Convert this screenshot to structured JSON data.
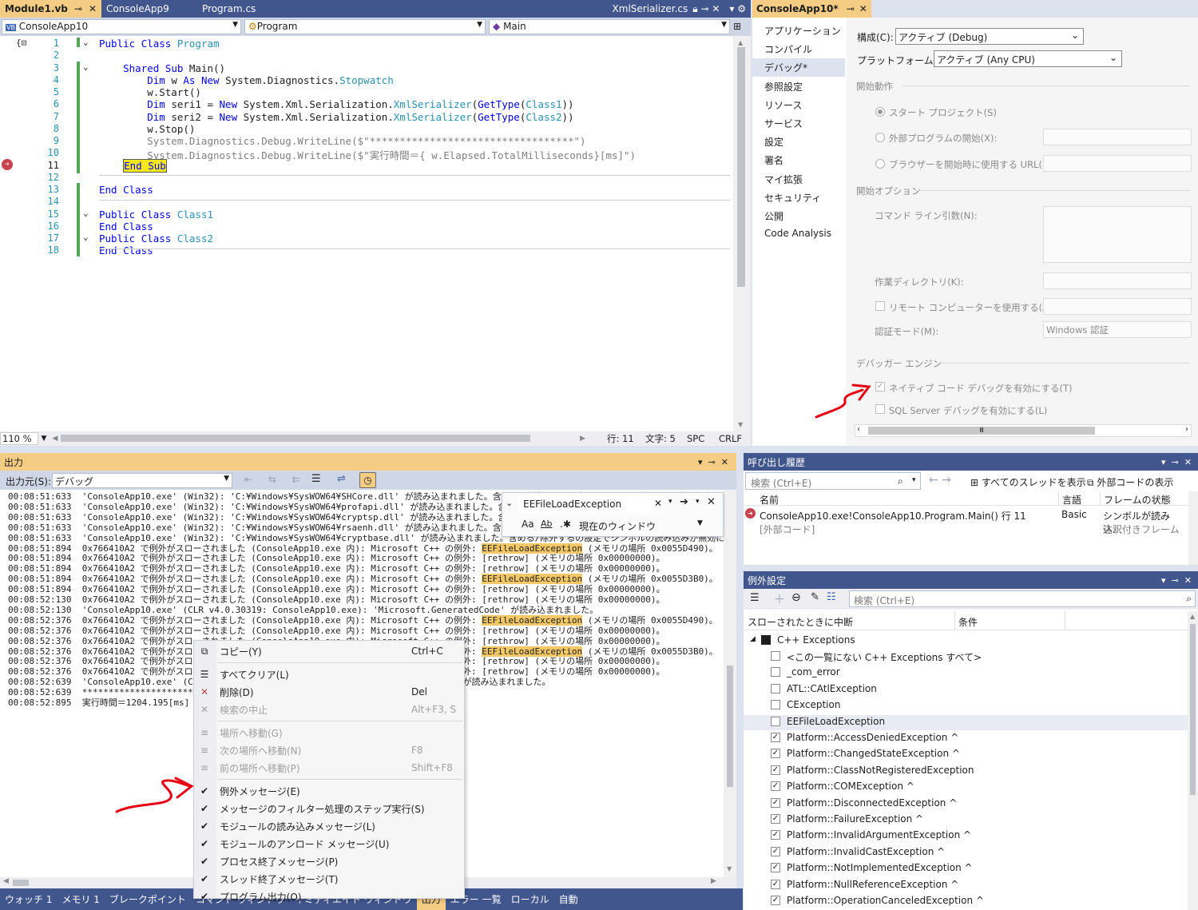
{
  "editor": {
    "tabs": [
      {
        "label": "Module1.vb",
        "active": true
      },
      {
        "label": "ConsoleApp9"
      },
      {
        "label": "Program.cs"
      },
      {
        "label": "XmlSerializer.cs",
        "right": true
      }
    ],
    "nav": {
      "project": "ConsoleApp10",
      "class": "Program",
      "member": "Main"
    },
    "line_numbers": [
      "1",
      "2",
      "3",
      "4",
      "5",
      "6",
      "7",
      "8",
      "9",
      "10",
      "11",
      "12",
      "13",
      "14",
      "15",
      "16",
      "17",
      "18"
    ],
    "code": [
      "Public Class Program",
      "",
      "    Shared Sub Main()",
      "        Dim w As New System.Diagnostics.Stopwatch",
      "        w.Start()",
      "        Dim seri1 = New System.Xml.Serialization.XmlSerializer(GetType(Class1))",
      "        Dim seri2 = New System.Xml.Serialization.XmlSerializer(GetType(Class2))",
      "        w.Stop()",
      "        System.Diagnostics.Debug.WriteLine($\"**********************************\")",
      "        System.Diagnostics.Debug.WriteLine($\"実行時間＝{ w.Elapsed.TotalMilliseconds}[ms]\")",
      "    End Sub",
      "",
      "End Class",
      "",
      "Public Class Class1",
      "End Class",
      "Public Class Class2",
      "End Class"
    ],
    "zoom": "110 %",
    "status": {
      "line": "行: 11",
      "char": "文字: 5",
      "spc": "SPC",
      "crlf": "CRLF"
    }
  },
  "props": {
    "title": "ConsoleApp10*",
    "nav": [
      "アプリケーション",
      "コンパイル",
      "デバッグ*",
      "参照設定",
      "リソース",
      "サービス",
      "設定",
      "署名",
      "マイ拡張",
      "セキュリティ",
      "公開",
      "Code Analysis"
    ],
    "config_label": "構成(C):",
    "config_value": "アクティブ (Debug)",
    "platform_label": "プラットフォーム(M):",
    "platform_value": "アクティブ (Any CPU)",
    "start_action": "開始動作",
    "radio_start_project": "スタート プロジェクト(S)",
    "radio_external": "外部プログラムの開始(X):",
    "radio_browser": "ブラウザーを開始時に使用する URL(R):",
    "start_options": "開始オプション",
    "cmdline": "コマンド ライン引数(N):",
    "workdir": "作業ディレクトリ(K):",
    "remote": "リモート コンピューターを使用する(A)",
    "auth_mode": "認証モード(M):",
    "auth_value": "Windows 認証",
    "debugger_engine": "デバッガー エンジン",
    "native_debug": "ネイティブ コード デバッグを有効にする(T)",
    "sql_debug": "SQL Server デバッグを有効にする(L)"
  },
  "output": {
    "title": "出力",
    "source_label": "出力元(S):",
    "source_value": "デバッグ",
    "lines": [
      {
        "t": "00:08:51:633",
        "m": "'ConsoleApp10.exe' (Win32): 'C:¥Windows¥SysWOW64¥SHCore.dll' が読み込まれました。含める/除外するの設定でシンボルの読み込みが無効になっています。"
      },
      {
        "t": "00:08:51:633",
        "m": "'ConsoleApp10.exe' (Win32): 'C:¥Windows¥SysWOW64¥profapi.dll' が読み込まれました。含める/除外するの設定でシンボルの読み込みが無効になっています。"
      },
      {
        "t": "00:08:51:633",
        "m": "'ConsoleApp10.exe' (Win32): 'C:¥Windows¥SysWOW64¥cryptsp.dll' が読み込まれました。含める/除外するの設定でシンボルの読み込みが無効になっています。"
      },
      {
        "t": "00:08:51:633",
        "m": "'ConsoleApp10.exe' (Win32): 'C:¥Windows¥SysWOW64¥rsaenh.dll' が読み込まれました。含める/除外するの設定でシンボルの読み込みが無効になっています。"
      },
      {
        "t": "00:08:51:633",
        "m": "'ConsoleApp10.exe' (Win32): 'C:¥Windows¥SysWOW64¥cryptbase.dll' が読み込まれました。含める/除外するの設定でシンボルの読み込みが無効にな"
      },
      {
        "t": "00:08:51:894",
        "m": "0x766410A2 で例外がスローされました (ConsoleApp10.exe 内): Microsoft C++ の例外: ",
        "h": "EEFileLoadException",
        "e": " (メモリの場所 0x0055D490)。"
      },
      {
        "t": "00:08:51:894",
        "m": "0x766410A2 で例外がスローされました (ConsoleApp10.exe 内): Microsoft C++ の例外: [rethrow] (メモリの場所 0x00000000)。"
      },
      {
        "t": "00:08:51:894",
        "m": "0x766410A2 で例外がスローされました (ConsoleApp10.exe 内): Microsoft C++ の例外: [rethrow] (メモリの場所 0x00000000)。"
      },
      {
        "t": "00:08:51:894",
        "m": "0x766410A2 で例外がスローされました (ConsoleApp10.exe 内): Microsoft C++ の例外: ",
        "h": "EEFileLoadException",
        "e": " (メモリの場所 0x0055D3B0)。"
      },
      {
        "t": "00:08:51:894",
        "m": "0x766410A2 で例外がスローされました (ConsoleApp10.exe 内): Microsoft C++ の例外: [rethrow] (メモリの場所 0x00000000)。"
      },
      {
        "t": "00:08:52:130",
        "m": "0x766410A2 で例外がスローされました (ConsoleApp10.exe 内): Microsoft C++ の例外: [rethrow] (メモリの場所 0x00000000)。"
      },
      {
        "t": "00:08:52:130",
        "m": "'ConsoleApp10.exe' (CLR v4.0.30319: ConsoleApp10.exe): 'Microsoft.GeneratedCode' が読み込まれました。"
      },
      {
        "t": "00:08:52:376",
        "m": "0x766410A2 で例外がスローされました (ConsoleApp10.exe 内): Microsoft C++ の例外: ",
        "h": "EEFileLoadException",
        "e": " (メモリの場所 0x0055D490)。"
      },
      {
        "t": "00:08:52:376",
        "m": "0x766410A2 で例外がスローされました (ConsoleApp10.exe 内): Microsoft C++ の例外: [rethrow] (メモリの場所 0x00000000)。"
      },
      {
        "t": "00:08:52:376",
        "m": "0x766410A2 で例外がスローされました (ConsoleApp10.exe 内): Microsoft C++ の例外: [rethrow] (メモリの場所 0x00000000)。"
      },
      {
        "t": "00:08:52:376",
        "m": "0x766410A2 で例外がスローされました (ConsoleApp10.exe 内): Microsoft C++ の例外: ",
        "h": "EEFileLoadException",
        "e": " (メモリの場所 0x0055D3B0)。"
      },
      {
        "t": "00:08:52:376",
        "m": "0x766410A2 で例外がスローされました (ConsoleApp10.exe 内): Microsoft C++ の例外: [rethrow] (メモリの場所 0x00000000)。"
      },
      {
        "t": "00:08:52:376",
        "m": "0x766410A2 で例外がスローされました (ConsoleApp10.exe 内): Microsoft C++ の例外: [rethrow] (メモリの場所 0x00000000)。"
      },
      {
        "t": "00:08:52:639",
        "m": "'ConsoleApp10.exe' (CLR v4.0.30319: ConsoleApp10.exe): 'System.Xml.dll' が読み込まれました。"
      },
      {
        "t": "00:08:52:639",
        "m": "**********************************"
      },
      {
        "t": "00:08:52:895",
        "m": "実行時間＝1204.195[ms]"
      }
    ]
  },
  "find": {
    "query": "EEFileLoadException",
    "case_icon": "Aa",
    "word_icon": "Ab",
    "scope": "現在のウィンドウ"
  },
  "context_menu": [
    {
      "label": "コピー(Y)",
      "shortcut": "Ctrl+C",
      "icon": "copy-icon",
      "glyph": "⧉"
    },
    {
      "sep": true
    },
    {
      "label": "すべてクリア(L)",
      "icon": "clear-all-icon",
      "glyph": "☰"
    },
    {
      "label": "削除(D)",
      "shortcut": "Del",
      "icon": "delete-icon",
      "glyph": "✕"
    },
    {
      "label": "検索の中止",
      "shortcut": "Alt+F3, S",
      "icon": "stop-search-icon",
      "glyph": "✕",
      "disabled": true
    },
    {
      "sep": true
    },
    {
      "label": "場所へ移動(G)",
      "icon": "goto-location-icon",
      "glyph": "≡",
      "disabled": true
    },
    {
      "label": "次の場所へ移動(N)",
      "shortcut": "F8",
      "icon": "next-location-icon",
      "glyph": "≡",
      "disabled": true
    },
    {
      "label": "前の場所へ移動(P)",
      "shortcut": "Shift+F8",
      "icon": "prev-location-icon",
      "glyph": "≡",
      "disabled": true
    },
    {
      "sep": true
    },
    {
      "label": "例外メッセージ(E)",
      "check": true
    },
    {
      "label": "メッセージのフィルター処理のステップ実行(S)",
      "check": true
    },
    {
      "label": "モジュールの読み込みメッセージ(L)",
      "check": true
    },
    {
      "label": "モジュールのアンロード メッセージ(U)",
      "check": true
    },
    {
      "label": "プロセス終了メッセージ(P)",
      "check": true
    },
    {
      "label": "スレッド終了メッセージ(T)",
      "check": true
    },
    {
      "label": "プログラム出力(O)",
      "check": true
    }
  ],
  "bottom_tabs": [
    "ウォッチ 1",
    "メモリ 1",
    "ブレークポイント",
    "コマンド ウィンドウ",
    "イミディエイト ウィンドウ",
    "出力",
    "エラー 一覧",
    "ローカル",
    "自動"
  ],
  "callstack": {
    "title": "呼び出し履歴",
    "search_placeholder": "検索 (Ctrl+E)",
    "show_threads": "すべてのスレッドを表示",
    "show_external": "外部コードの表示",
    "columns": [
      "名前",
      "言語",
      "フレームの状態"
    ],
    "rows": [
      {
        "name": "ConsoleApp10.exe!ConsoleApp10.Program.Main() 行 11",
        "lang": "Basic",
        "state": "シンボルが読み込..."
      },
      {
        "name": "[外部コード]",
        "lang": "",
        "state": "注釈付きフレーム"
      }
    ]
  },
  "exceptions": {
    "title": "例外設定",
    "search_placeholder": "検索 (Ctrl+E)",
    "columns": [
      "スローされたときに中断",
      "条件"
    ],
    "group": "C++ Exceptions",
    "items": [
      {
        "label": "<この一覧にない C++ Exceptions すべて>",
        "checked": false
      },
      {
        "label": "_com_error",
        "checked": false
      },
      {
        "label": "ATL::CAtlException",
        "checked": false
      },
      {
        "label": "CException",
        "checked": false
      },
      {
        "label": "EEFileLoadException",
        "checked": false,
        "selected": true
      },
      {
        "label": "Platform::AccessDeniedException ^",
        "checked": true
      },
      {
        "label": "Platform::ChangedStateException ^",
        "checked": true
      },
      {
        "label": "Platform::ClassNotRegisteredException",
        "checked": true
      },
      {
        "label": "Platform::COMException ^",
        "checked": true
      },
      {
        "label": "Platform::DisconnectedException ^",
        "checked": true
      },
      {
        "label": "Platform::FailureException ^",
        "checked": true
      },
      {
        "label": "Platform::InvalidArgumentException ^",
        "checked": true
      },
      {
        "label": "Platform::InvalidCastException ^",
        "checked": true
      },
      {
        "label": "Platform::NotImplementedException ^",
        "checked": true
      },
      {
        "label": "Platform::NullReferenceException ^",
        "checked": true
      },
      {
        "label": "Platform::OperationCanceledException ^",
        "checked": true
      }
    ]
  },
  "colors": {
    "accent": "#f5cc84",
    "tab_blue": "#40568d",
    "highlight": "#f5c867",
    "annotation": "#e60012"
  }
}
